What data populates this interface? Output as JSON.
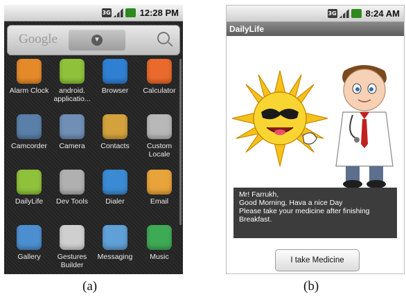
{
  "phone_a": {
    "status": {
      "network": "3G",
      "time": "12:28 PM"
    },
    "search": {
      "placeholder": "Google"
    },
    "apps": [
      {
        "label": "Alarm Clock",
        "icon": "alarm-clock-icon",
        "color": "#e58a2b"
      },
      {
        "label": "android. applicatio...",
        "icon": "android-app-icon",
        "color": "#8fc23a"
      },
      {
        "label": "Browser",
        "icon": "globe-icon",
        "color": "#2f7fd3"
      },
      {
        "label": "Calculator",
        "icon": "calculator-icon",
        "color": "#e96a2c"
      },
      {
        "label": "Camcorder",
        "icon": "camcorder-icon",
        "color": "#5a7fa8"
      },
      {
        "label": "Camera",
        "icon": "camera-icon",
        "color": "#6f8fb5"
      },
      {
        "label": "Contacts",
        "icon": "contacts-icon",
        "color": "#d4a23c"
      },
      {
        "label": "Custom Locale",
        "icon": "gear-icon",
        "color": "#b8b8b8"
      },
      {
        "label": "DailyLife",
        "icon": "android-app-icon",
        "color": "#8fc23a"
      },
      {
        "label": "Dev Tools",
        "icon": "gear-icon",
        "color": "#b0b0b0"
      },
      {
        "label": "Dialer",
        "icon": "phone-icon",
        "color": "#3a8bd4"
      },
      {
        "label": "Email",
        "icon": "email-icon",
        "color": "#e8a33a"
      },
      {
        "label": "Gallery",
        "icon": "gallery-icon",
        "color": "#4c8fd1"
      },
      {
        "label": "Gestures Builder",
        "icon": "gestures-icon",
        "color": "#cfcfcf"
      },
      {
        "label": "Messaging",
        "icon": "messaging-icon",
        "color": "#5fa0d6"
      },
      {
        "label": "Music",
        "icon": "music-icon",
        "color": "#3faa55"
      }
    ]
  },
  "phone_b": {
    "status": {
      "network": "3G",
      "time": "8:24 AM"
    },
    "app_title": "DailyLife",
    "message_lines": [
      "Mr! Farrukh,",
      "Good Morning, Hava a nice Day",
      "Please take your medicine after finishing",
      "Breakfast."
    ],
    "button_label": "I take Medicine"
  },
  "captions": {
    "a": "(a)",
    "b": "(b)"
  }
}
